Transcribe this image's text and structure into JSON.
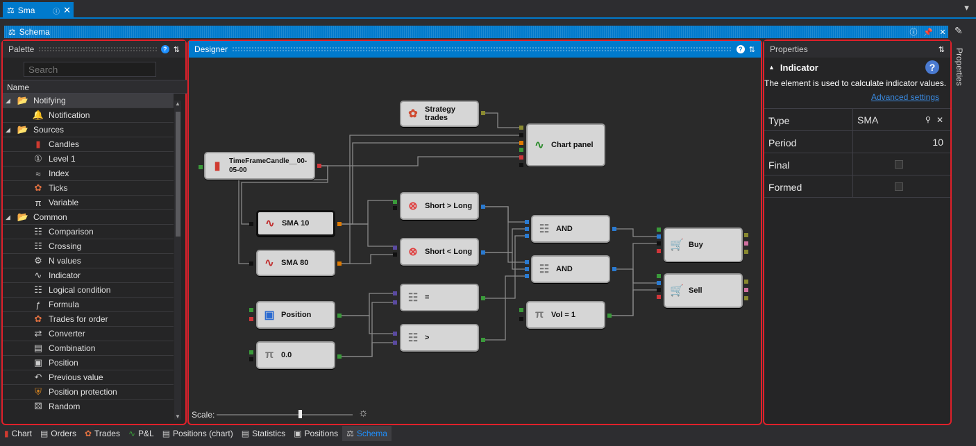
{
  "doc_tab": {
    "title": "Sma"
  },
  "schema_header": {
    "title": "Schema"
  },
  "palette": {
    "title": "Palette",
    "search_placeholder": "Search",
    "column_header": "Name",
    "groups": [
      {
        "label": "Notifying",
        "items": [
          {
            "label": "Notification",
            "icon": "bell-icon"
          }
        ]
      },
      {
        "label": "Sources",
        "items": [
          {
            "label": "Candles",
            "icon": "candles-icon"
          },
          {
            "label": "Level 1",
            "icon": "level1-icon"
          },
          {
            "label": "Index",
            "icon": "index-icon"
          },
          {
            "label": "Ticks",
            "icon": "ticks-icon"
          },
          {
            "label": "Variable",
            "icon": "pi-icon"
          }
        ]
      },
      {
        "label": "Common",
        "items": [
          {
            "label": "Comparison",
            "icon": "comparison-icon"
          },
          {
            "label": "Crossing",
            "icon": "crossing-icon"
          },
          {
            "label": "N values",
            "icon": "n-values-icon"
          },
          {
            "label": "Indicator",
            "icon": "indicator-icon"
          },
          {
            "label": "Logical condition",
            "icon": "logical-icon"
          },
          {
            "label": "Formula",
            "icon": "formula-icon"
          },
          {
            "label": "Trades for order",
            "icon": "trades-icon"
          },
          {
            "label": "Converter",
            "icon": "converter-icon"
          },
          {
            "label": "Combination",
            "icon": "combination-icon"
          },
          {
            "label": "Position",
            "icon": "position-icon"
          },
          {
            "label": "Previous value",
            "icon": "previous-icon"
          },
          {
            "label": "Position protection",
            "icon": "shield-icon"
          },
          {
            "label": "Random",
            "icon": "dice-icon"
          }
        ]
      }
    ]
  },
  "designer": {
    "title": "Designer",
    "scale_label": "Scale:",
    "scale_value": 0.62,
    "nodes": {
      "strategy_trades": "Strategy trades",
      "chart_panel": "Chart panel",
      "timeframe": "TimeFrameCandle__00-05-00",
      "sma10": "SMA 10",
      "sma80": "SMA 80",
      "short_gt_long": "Short > Long",
      "short_lt_long": "Short < Long",
      "and1": "AND",
      "and2": "AND",
      "buy": "Buy",
      "sell": "Sell",
      "position": "Position",
      "zero": "0.0",
      "eq": "=",
      "gt": ">",
      "vol": "Vol = 1"
    }
  },
  "properties": {
    "title": "Properties",
    "section": "Indicator",
    "description": "The element is used to calculate indicator values.",
    "advanced_link": "Advanced settings",
    "rows": [
      {
        "key": "Type",
        "value": "SMA"
      },
      {
        "key": "Period",
        "value": "10"
      },
      {
        "key": "Final",
        "value": ""
      },
      {
        "key": "Formed",
        "value": ""
      }
    ]
  },
  "side_tab": "Properties",
  "bottom_tabs": [
    {
      "label": "Chart",
      "icon": "chart-icon"
    },
    {
      "label": "Orders",
      "icon": "orders-icon"
    },
    {
      "label": "Trades",
      "icon": "trades-icon"
    },
    {
      "label": "P&L",
      "icon": "pnl-icon"
    },
    {
      "label": "Positions (chart)",
      "icon": "positions-chart-icon"
    },
    {
      "label": "Statistics",
      "icon": "statistics-icon"
    },
    {
      "label": "Positions",
      "icon": "positions-icon"
    },
    {
      "label": "Schema",
      "icon": "schema-icon"
    }
  ],
  "colors": {
    "accent": "#007acc",
    "highlight": "#e0202a"
  }
}
